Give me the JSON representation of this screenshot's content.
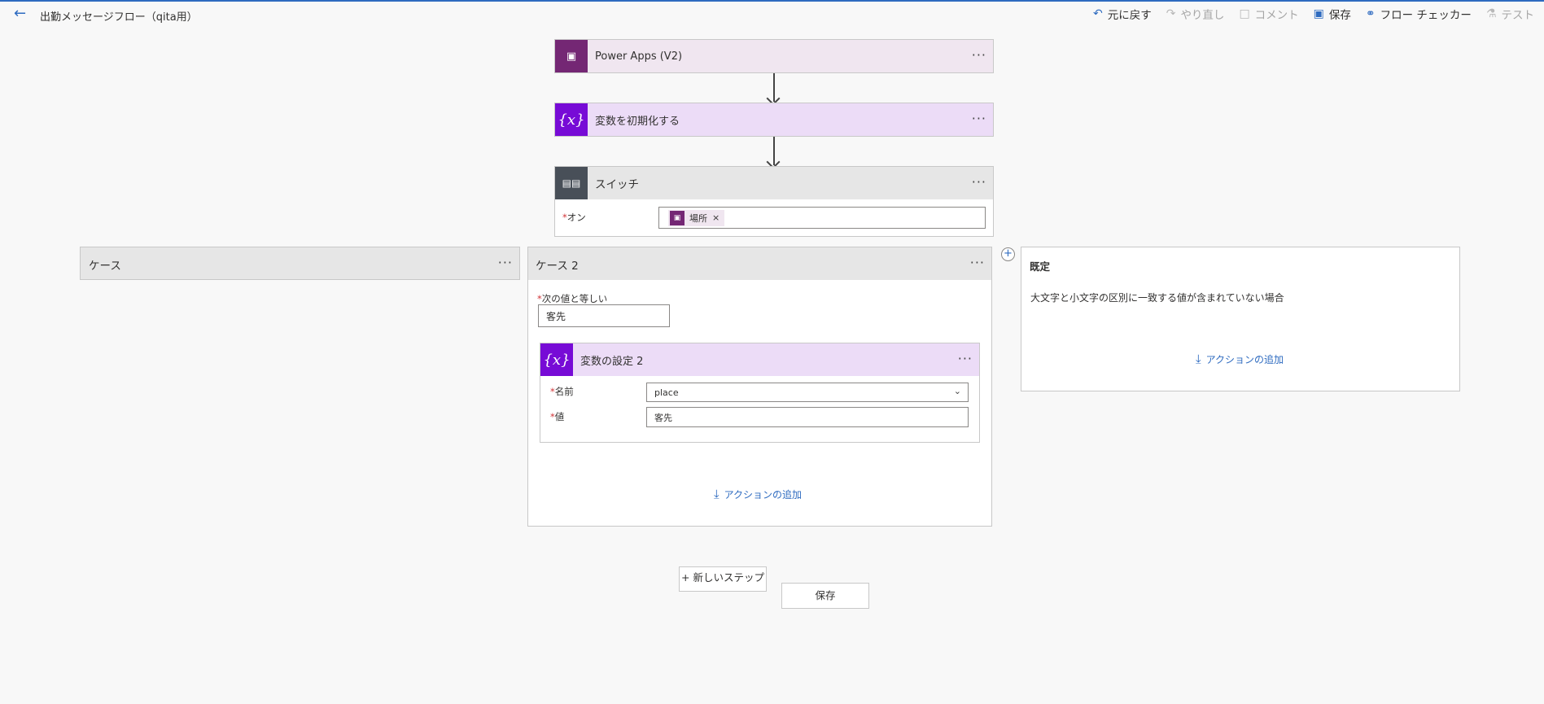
{
  "header": {
    "title": "出勤メッセージフロー（qita用）",
    "commands": [
      {
        "label": "元に戻す",
        "icon": "undo-icon",
        "enabled": true
      },
      {
        "label": "やり直し",
        "icon": "redo-icon",
        "enabled": false
      },
      {
        "label": "コメント",
        "icon": "comment-icon",
        "enabled": false
      },
      {
        "label": "保存",
        "icon": "save-icon",
        "enabled": true
      },
      {
        "label": "フロー チェッカー",
        "icon": "stethoscope-icon",
        "enabled": true
      },
      {
        "label": "テスト",
        "icon": "flask-icon",
        "enabled": false
      }
    ]
  },
  "steps": {
    "trigger": {
      "title": "Power Apps (V2)",
      "icon": "power-apps-icon",
      "color": "#742774"
    },
    "init_var": {
      "title": "変数を初期化する",
      "icon": "variable-icon",
      "color": "#770bd6"
    },
    "switch": {
      "title": "スイッチ",
      "icon": "switch-icon",
      "color": "#484f58",
      "on_label": "オン",
      "on_token": "場所"
    }
  },
  "cases": {
    "case1": {
      "title": "ケース"
    },
    "case2": {
      "title": "ケース 2",
      "equals_label": "次の値と等しい",
      "equals_value": "客先",
      "set_var": {
        "title": "変数の設定 2",
        "name_label": "名前",
        "name_value": "place",
        "value_label": "値",
        "value_value": "客先"
      },
      "add_action": "アクションの追加"
    },
    "default": {
      "title": "既定",
      "description": "大文字と小文字の区別に一致する値が含まれていない場合",
      "add_action": "アクションの追加"
    }
  },
  "footer": {
    "new_step_label": "+ 新しいステップ",
    "save_label": "保存"
  },
  "colors": {
    "accent": "#2e6bc0",
    "required": "#d13438"
  }
}
